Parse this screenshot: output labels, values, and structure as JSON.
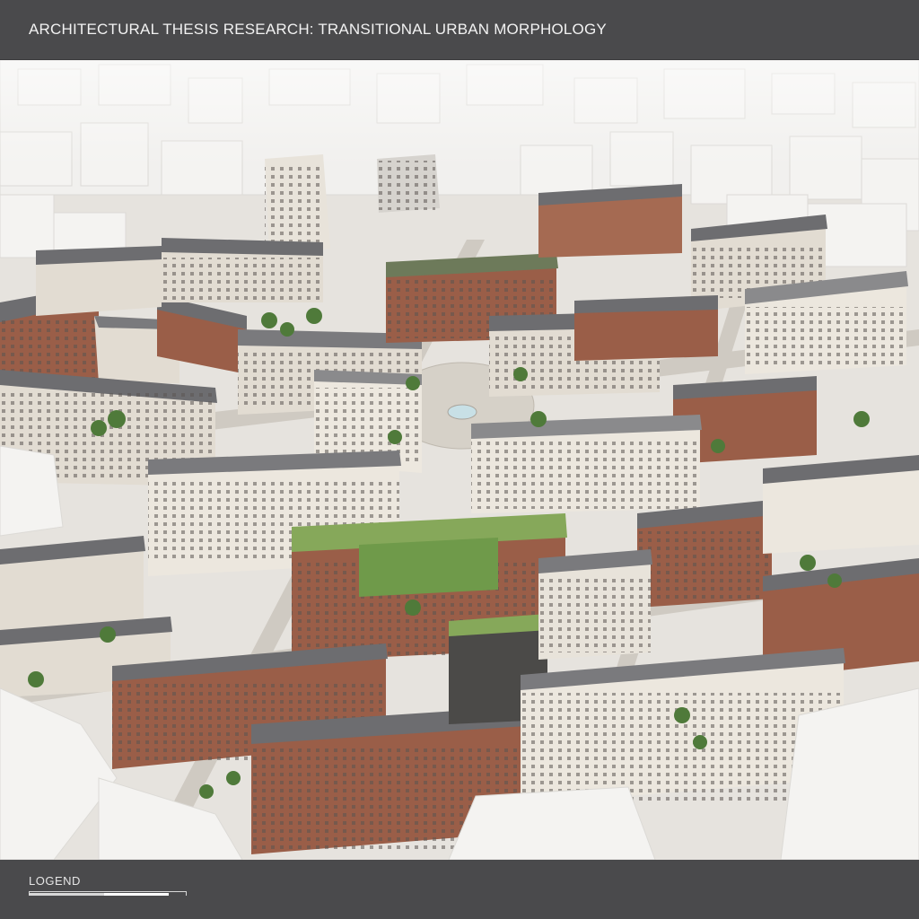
{
  "header": {
    "title": "ARCHITECTURAL THESIS RESEARCH: TRANSITIONAL URBAN MORPHOLOGY"
  },
  "render": {
    "description_icon": "aerial-city-model-image",
    "colors": {
      "context_massing": "#f4f3f1",
      "brick": "#9a5e48",
      "roof_slate": "#6d6d70",
      "facade_light": "#e2dcd2",
      "green_roof": "#86a85a",
      "trees": "#4f7a3a",
      "plaza": "#cfcac2"
    }
  },
  "footer": {
    "legend_label": "LOGEND",
    "scale_bar_icon": "scale-bar-icon"
  }
}
